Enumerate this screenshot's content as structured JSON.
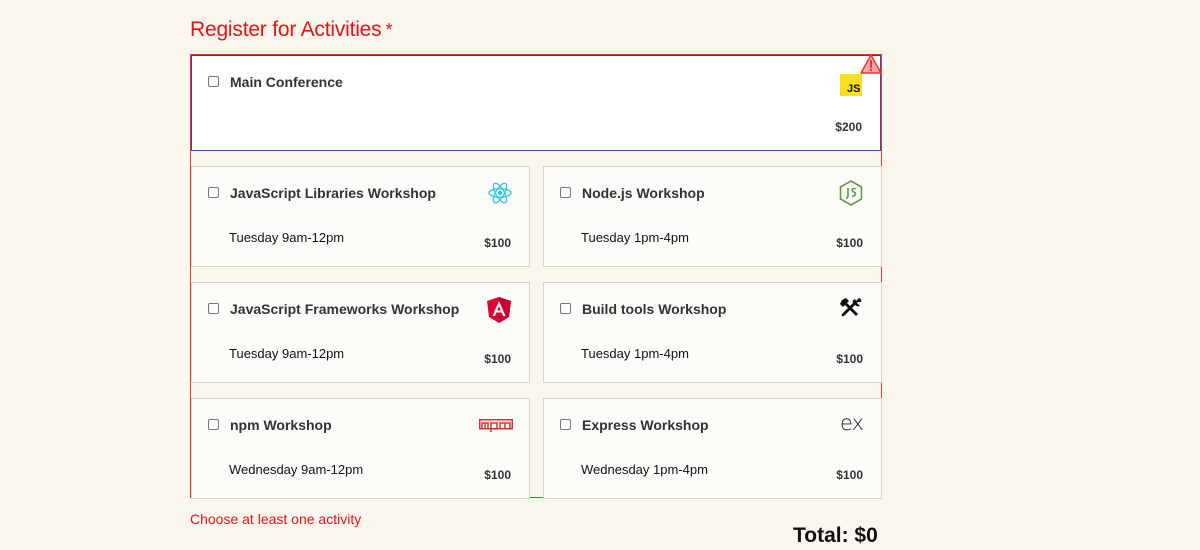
{
  "heading": {
    "title": "Register for Activities",
    "required_mark": "*"
  },
  "main_conference": {
    "title": "Main Conference",
    "price": "$200"
  },
  "workshops": [
    {
      "title": "JavaScript Libraries Workshop",
      "time": "Tuesday 9am-12pm",
      "price": "$100",
      "icon": "react-icon"
    },
    {
      "title": "Node.js Workshop",
      "time": "Tuesday 1pm-4pm",
      "price": "$100",
      "icon": "nodejs-icon"
    },
    {
      "title": "JavaScript Frameworks Workshop",
      "time": "Tuesday 9am-12pm",
      "price": "$100",
      "icon": "angular-icon"
    },
    {
      "title": "Build tools Workshop",
      "time": "Tuesday 1pm-4pm",
      "price": "$100",
      "icon": "tools-icon"
    },
    {
      "title": "npm Workshop",
      "time": "Wednesday 9am-12pm",
      "price": "$100",
      "icon": "npm-icon"
    },
    {
      "title": "Express Workshop",
      "time": "Wednesday 1pm-4pm",
      "price": "$100",
      "icon": "express-icon"
    }
  ],
  "icons": {
    "js_label": "JS",
    "express_label": "ex"
  },
  "error": {
    "message": "Choose at least one activity"
  },
  "total": {
    "label": "Total: $0"
  },
  "colors": {
    "error": "#e31313",
    "background": "#fcf7ee",
    "accent_border": "#3b4aa8"
  }
}
